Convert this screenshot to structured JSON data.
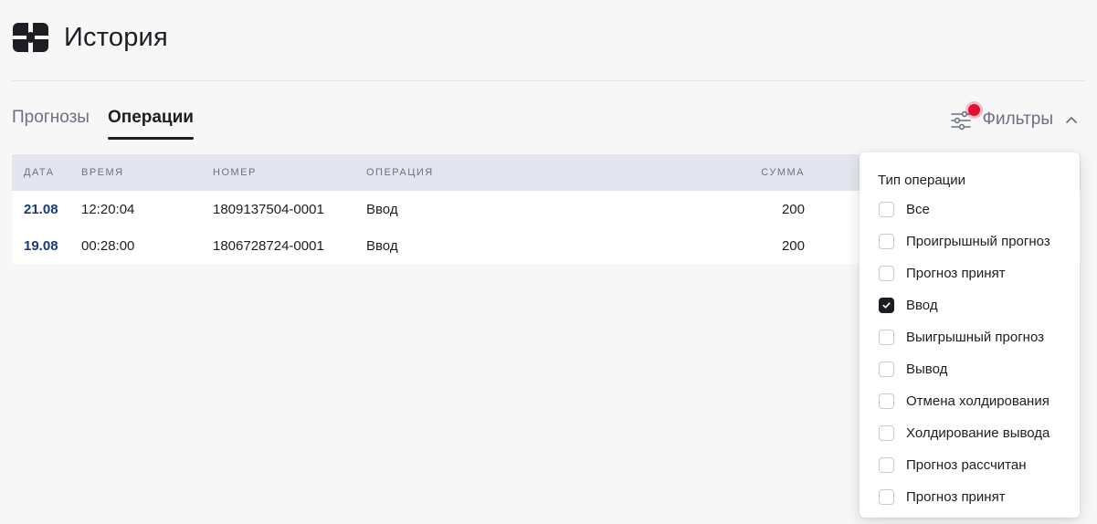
{
  "header": {
    "title": "История",
    "logo_icon": "logo-icon"
  },
  "tabs": [
    {
      "label": "Прогнозы",
      "active": false
    },
    {
      "label": "Операции",
      "active": true
    }
  ],
  "filters": {
    "label": "Фильтры",
    "icon": "sliders-icon",
    "indicator_color": "#e0102e",
    "expanded": true
  },
  "table": {
    "columns": [
      "Дата",
      "Время",
      "Номер",
      "Операция",
      "Сумма"
    ],
    "rows": [
      {
        "date": "21.08",
        "time": "12:20:04",
        "number": "1809137504-0001",
        "operation": "Ввод",
        "amount": "200"
      },
      {
        "date": "19.08",
        "time": "00:28:00",
        "number": "1806728724-0001",
        "operation": "Ввод",
        "amount": "200"
      }
    ]
  },
  "dropdown": {
    "title": "Тип операции",
    "options": [
      {
        "label": "Все",
        "checked": false
      },
      {
        "label": "Проигрышный прогноз",
        "checked": false
      },
      {
        "label": "Прогноз принят",
        "checked": false
      },
      {
        "label": "Ввод",
        "checked": true
      },
      {
        "label": "Выигрышный прогноз",
        "checked": false
      },
      {
        "label": "Вывод",
        "checked": false
      },
      {
        "label": "Отмена холдирования",
        "checked": false
      },
      {
        "label": "Холдирование вывода",
        "checked": false
      },
      {
        "label": "Прогноз рассчитан",
        "checked": false
      },
      {
        "label": "Прогноз принят",
        "checked": false
      }
    ]
  },
  "colors": {
    "date_accent": "#183a7a",
    "text": "#1c1e24",
    "muted": "#6b7180",
    "header_bg": "#e3e6ee"
  }
}
